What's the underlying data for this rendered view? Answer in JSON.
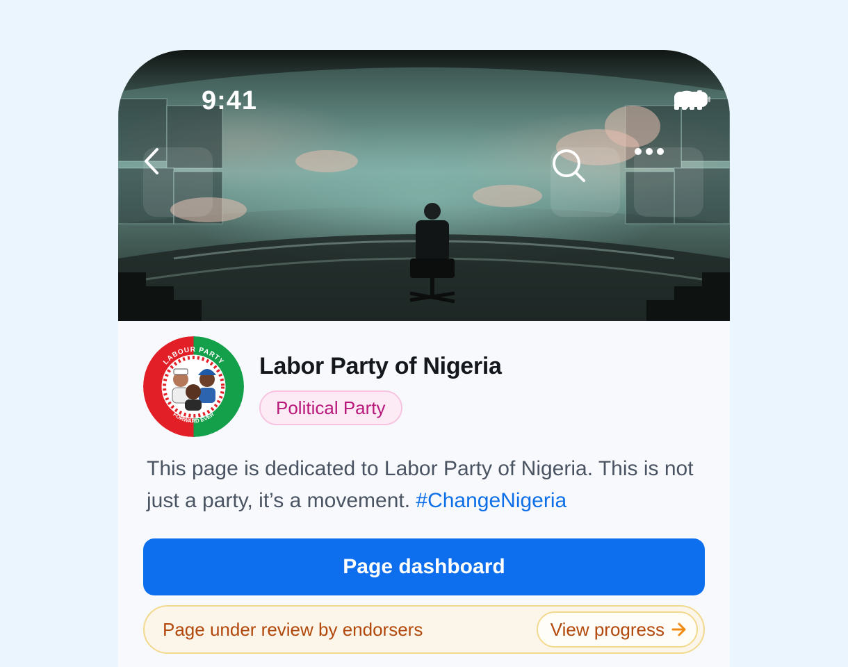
{
  "status_bar": {
    "time": "9:41"
  },
  "navigation": {
    "back_icon": "chevron-left-icon",
    "search_icon": "search-icon",
    "more_icon": "more-horizontal-icon"
  },
  "profile": {
    "title": "Labor Party of Nigeria",
    "category": "Political Party",
    "logo_text_top": "LABOUR PARTY",
    "logo_text_bottom": "FORWARD EVER",
    "description": "This page is dedicated to Labor Party of Nigeria. This is not just a party, it’s a movement. ",
    "hashtag": "#ChangeNigeria"
  },
  "actions": {
    "primary_label": "Page dashboard"
  },
  "review": {
    "message": "Page under review by endorsers",
    "link_label": "View progress",
    "link_icon": "arrow-right-icon"
  },
  "colors": {
    "primary": "#0d6fee",
    "tag_text": "#b8187a",
    "review_text": "#b2480c",
    "hashtag": "#0d6fe8"
  }
}
